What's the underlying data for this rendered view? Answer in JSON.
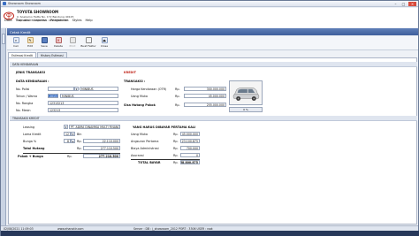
{
  "window": {
    "title": "Showroom Showroom"
  },
  "company": {
    "name": "TOYOTA SHOWROOM",
    "address": "Jl. Soekarno Hatta No. 172 Bandung 40125",
    "phone": "Telp. 022-7805987  Fax. 022-88008788"
  },
  "menu": [
    "Data",
    "Transaksi",
    "Laporan",
    "Pengaturan",
    "Styles",
    "Help"
  ],
  "panel": {
    "title": "Cetak Kredit"
  },
  "toolbar": [
    {
      "label": "Cari",
      "icon": "search-icon",
      "disabled": false
    },
    {
      "label": "Edit",
      "icon": "edit-icon",
      "disabled": false
    },
    {
      "label": "Save",
      "icon": "save-icon",
      "disabled": false
    },
    {
      "label": "Delete",
      "icon": "delete-icon",
      "disabled": false
    },
    {
      "label": "Print",
      "icon": "print-icon",
      "disabled": true
    },
    {
      "label": "Buat Faktur",
      "icon": "invoice-icon",
      "disabled": false
    },
    {
      "label": "Close",
      "icon": "close-icon",
      "disabled": false
    }
  ],
  "tabs": [
    "Estimasi Kredit",
    "History Estimasi"
  ],
  "sections": {
    "data_kendaraan": "DATA KENDARAAN",
    "transaksi_kredit": "TRANSAKSI KREDIT"
  },
  "left": {
    "jenis_transaksi_label": "JENIS TRANSAKSI",
    "jenis_transaksi_value": "KREDIT",
    "data_kendaraan_label": "DATA KENDARAAN :",
    "no_polisi_label": "No. Polisi",
    "no_polisi_value": "",
    "no_polisi_type": "MINIBUS",
    "tahun_warna_label": "Tahun / Warna",
    "tahun_value": "2015",
    "warna_value": "MINIBUS",
    "no_rangka_label": "No. Rangka",
    "no_rangka_value": "12313213",
    "no_mesin_label": "No. Mesin",
    "no_mesin_value": "123213"
  },
  "right": {
    "transaksi_label": "TRANSAKSI :",
    "harga_otr_label": "Harga Kendaraan (OTR)",
    "harga_otr_value": "300.000.000",
    "uang_muka_label": "Uang Muka",
    "uang_muka_value": "45.000.000",
    "sisa_hutang_label": "Sisa Hutang Pokok",
    "sisa_hutang_value": "255.000.000",
    "rp": "Rp.",
    "car_btn": "0 %"
  },
  "credit": {
    "leasing_label": "Leasing",
    "leasing_value": "PT. ADIRA DINAMIKA MULTI FINANCE",
    "lama_label": "Lama Kredit",
    "lama_value": "12",
    "lama_unit": "Bln",
    "bunga_label": "Bunga %",
    "bunga_value": "8",
    "bunga_amount": "22.110.000",
    "total_hutang_label": "Total Hutang",
    "total_hutang_value": "277.110.500",
    "pokok_bunga_label": "Pokok + Bunga",
    "pokok_bunga_value": "277.210.500",
    "bayar_title": "YANG HARUS DIBAYAR PERTAMA KALI",
    "uang_muka_label": "Uang Muka",
    "uang_muka_value": "45.000.000",
    "angsuran_label": "Angsuran Pertama",
    "angsuran_value": "23.100.875",
    "biaya_admin_label": "Biaya Administrasi",
    "biaya_admin_value": "700.000",
    "asuransi_label": "Asuransi",
    "asuransi_value": "0",
    "total_bayar_label": "TOTAL BAYAR",
    "total_bayar_value": "68.800.875",
    "rp": "Rp."
  },
  "statusbar": {
    "date": "02/08/2021 11:09:03",
    "site": "www.ehanotir.com",
    "server": "Server : DB : j_showroom_2012  PORT : 3306  USER : root"
  },
  "colors": {
    "accent": "#3f5f9c",
    "danger": "#c0261b"
  }
}
